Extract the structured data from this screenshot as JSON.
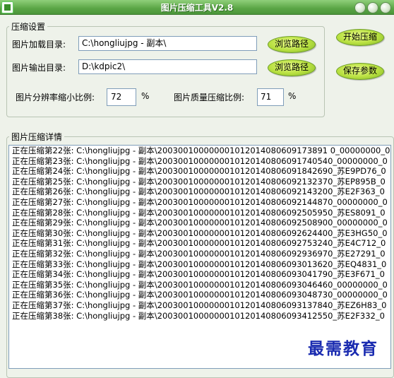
{
  "window": {
    "title": "图片压缩工具V2.8"
  },
  "settings": {
    "group_label": "压缩设置",
    "load_dir_label": "图片加载目录:",
    "load_dir_value": "C:\\hongliujpg - 副本\\",
    "output_dir_label": "图片输出目录:",
    "output_dir_value": "D:\\kdpic2\\",
    "browse_label": "浏览路径",
    "resolution_label": "图片分辨率缩小比例:",
    "resolution_value": "72",
    "quality_label": "图片质量压缩比例:",
    "quality_value": "71",
    "percent": "%"
  },
  "actions": {
    "start_label": "开始压缩",
    "save_label": "保存参数"
  },
  "details": {
    "group_label": "图片压缩详情",
    "lines": [
      "正在压缩第22张: C:\\hongliujpg - 副本\\200300100000001012014080609173891 0_00000000_0",
      "正在压缩第23张: C:\\hongliujpg - 副本\\2003001000000010120140806091740540_00000000_0",
      "正在压缩第24张: C:\\hongliujpg - 副本\\2003001000000010120140806091842690_苏E9PD76_0",
      "正在压缩第25张: C:\\hongliujpg - 副本\\2003001000000010120140806092132370_苏EP895B_0",
      "正在压缩第26张: C:\\hongliujpg - 副本\\2003001000000010120140806092143200_苏E2F363_0",
      "正在压缩第27张: C:\\hongliujpg - 副本\\2003001000000010120140806092144870_00000000_0",
      "正在压缩第28张: C:\\hongliujpg - 副本\\2003001000000010120140806092505950_苏ES8091_0",
      "正在压缩第29张: C:\\hongliujpg - 副本\\2003001000000010120140806092508900_00000000_0",
      "正在压缩第30张: C:\\hongliujpg - 副本\\2003001000000010120140806092624400_苏E3HG50_0",
      "正在压缩第31张: C:\\hongliujpg - 副本\\2003001000000010120140806092753240_苏E4C712_0",
      "正在压缩第32张: C:\\hongliujpg - 副本\\2003001000000010120140806092936970_苏E27291_0",
      "正在压缩第33张: C:\\hongliujpg - 副本\\2003001000000010120140806093013620_苏EQ4831_0",
      "正在压缩第34张: C:\\hongliujpg - 副本\\2003001000000010120140806093041790_苏E3F671_0",
      "正在压缩第35张: C:\\hongliujpg - 副本\\2003001000000010120140806093046460_00000000_0",
      "正在压缩第36张: C:\\hongliujpg - 副本\\2003001000000010120140806093048730_00000000_0",
      "正在压缩第37张: C:\\hongliujpg - 副本\\2003001000000010120140806093137840_苏EZ6H83_0",
      "正在压缩第38张: C:\\hongliujpg - 副本\\2003001000000010120140806093412550_苏E2F332_0"
    ]
  },
  "watermark": "最需教育"
}
